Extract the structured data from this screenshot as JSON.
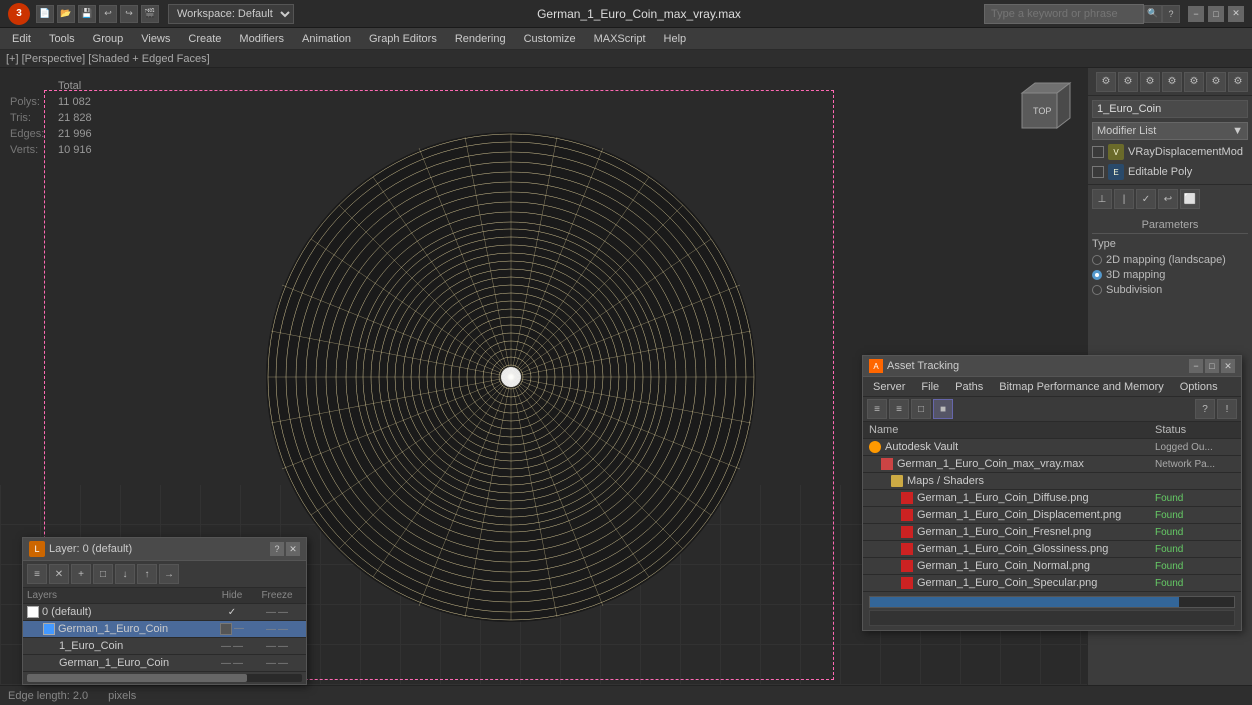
{
  "titlebar": {
    "logo": "3",
    "workspace": "Workspace: Default",
    "title": "German_1_Euro_Coin_max_vray.max",
    "search_placeholder": "Type a keyword or phrase",
    "win_min": "−",
    "win_max": "□",
    "win_close": "✕"
  },
  "menu": {
    "items": [
      "Edit",
      "Tools",
      "Group",
      "Views",
      "Create",
      "Modifiers",
      "Animation",
      "Graph Editors",
      "Rendering",
      "Customize",
      "MAXScript",
      "Help"
    ]
  },
  "viewport": {
    "label": "[+] [Perspective] [Shaded + Edged Faces]",
    "stats": {
      "header": "Total",
      "rows": [
        {
          "label": "Polys:",
          "value": "11 082"
        },
        {
          "label": "Tris:",
          "value": "21 828"
        },
        {
          "label": "Edges:",
          "value": "21 996"
        },
        {
          "label": "Verts:",
          "value": "10 916"
        }
      ]
    }
  },
  "right_panel": {
    "object_name": "1_Euro_Coin",
    "modifier_list_label": "Modifier List",
    "modifiers": [
      {
        "name": "VRayDisplacementMod",
        "type": "yellow"
      },
      {
        "name": "Editable Poly",
        "type": "blue"
      }
    ],
    "parameters": {
      "title": "Parameters",
      "type_label": "Type",
      "options": [
        {
          "label": "2D mapping (landscape)",
          "selected": false
        },
        {
          "label": "3D mapping",
          "selected": true
        },
        {
          "label": "Subdivision",
          "selected": false
        }
      ]
    }
  },
  "status_bar": {
    "edge_length": "Edge length: 2.0",
    "pixels": "pixels"
  },
  "layer_panel": {
    "title": "Layer: 0 (default)",
    "question": "?",
    "close": "✕",
    "toolbar_buttons": [
      "≡",
      "✕",
      "+",
      "□",
      "↓",
      "↑",
      "→"
    ],
    "columns": {
      "layers": "Layers",
      "hide": "Hide",
      "freeze": "Freeze"
    },
    "rows": [
      {
        "name": "0 (default)",
        "indent": 0,
        "active": false,
        "check": true
      },
      {
        "name": "German_1_Euro_Coin",
        "indent": 1,
        "active": true
      },
      {
        "name": "1_Euro_Coin",
        "indent": 2,
        "active": false
      },
      {
        "name": "German_1_Euro_Coin",
        "indent": 2,
        "active": false
      }
    ]
  },
  "asset_panel": {
    "title": "Asset Tracking",
    "close": "✕",
    "min": "−",
    "max": "□",
    "menu_items": [
      "Server",
      "File",
      "Paths",
      "Bitmap Performance and Memory",
      "Options"
    ],
    "toolbar_left": [
      "≡",
      "≡",
      "□",
      "■"
    ],
    "toolbar_right": [
      "?",
      "!"
    ],
    "columns": {
      "name": "Name",
      "status": "Status"
    },
    "rows": [
      {
        "name": "Autodesk Vault",
        "indent": 0,
        "type": "vault",
        "status": "Logged Ou...",
        "status_class": "status-logged"
      },
      {
        "name": "German_1_Euro_Coin_max_vray.max",
        "indent": 1,
        "type": "file",
        "status": "Network Pa...",
        "status_class": "status-logged"
      },
      {
        "name": "Maps / Shaders",
        "indent": 2,
        "type": "folder",
        "status": "",
        "status_class": ""
      },
      {
        "name": "German_1_Euro_Coin_Diffuse.png",
        "indent": 3,
        "type": "img",
        "status": "Found",
        "status_class": "status-found"
      },
      {
        "name": "German_1_Euro_Coin_Displacement.png",
        "indent": 3,
        "type": "img",
        "status": "Found",
        "status_class": "status-found"
      },
      {
        "name": "German_1_Euro_Coin_Fresnel.png",
        "indent": 3,
        "type": "img",
        "status": "Found",
        "status_class": "status-found"
      },
      {
        "name": "German_1_Euro_Coin_Glossiness.png",
        "indent": 3,
        "type": "img",
        "status": "Found",
        "status_class": "status-found"
      },
      {
        "name": "German_1_Euro_Coin_Normal.png",
        "indent": 3,
        "type": "img",
        "status": "Found",
        "status_class": "status-found"
      },
      {
        "name": "German_1_Euro_Coin_Specular.png",
        "indent": 3,
        "type": "img",
        "status": "Found",
        "status_class": "status-found"
      }
    ]
  }
}
